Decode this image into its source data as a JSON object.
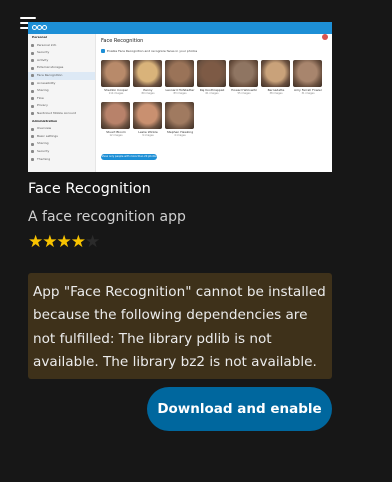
{
  "menu": {
    "icon": "hamburger-icon"
  },
  "preview": {
    "title": "Face Recognition",
    "checkbox_label": "Enable Face Recognition and recognize faces in your photos",
    "button_label": "Show only people with more than 20 photos",
    "sidebar": [
      {
        "label": "Personal",
        "head": true
      },
      {
        "label": "Personal info"
      },
      {
        "label": "Security"
      },
      {
        "label": "Activity"
      },
      {
        "label": "External storages"
      },
      {
        "label": "Face Recognition",
        "active": true
      },
      {
        "label": "Accessibility"
      },
      {
        "label": "Sharing"
      },
      {
        "label": "Flow"
      },
      {
        "label": "Privacy"
      },
      {
        "label": "Nextcloud Mobile Account"
      },
      {
        "label": "Administration",
        "head": true
      },
      {
        "label": "Overview"
      },
      {
        "label": "Basic settings"
      },
      {
        "label": "Sharing"
      },
      {
        "label": "Security"
      },
      {
        "label": "Theming"
      }
    ],
    "faces": [
      {
        "name": "Sheldon Cooper",
        "count": "114 images",
        "color": "#b88a6a"
      },
      {
        "name": "Penny",
        "count": "89 images",
        "color": "#d9b37a"
      },
      {
        "name": "Leonard Hofstadter",
        "count": "83 images",
        "color": "#9a7358"
      },
      {
        "name": "Raj Koothrappali",
        "count": "61 images",
        "color": "#7d5a45"
      },
      {
        "name": "Howard Wolowitz",
        "count": "55 images",
        "color": "#8f7562"
      },
      {
        "name": "Bernadette",
        "count": "38 images",
        "color": "#c9a27a"
      },
      {
        "name": "Amy Farrah Fowler",
        "count": "31 images",
        "color": "#a8856d"
      },
      {
        "name": "Stuart Bloom",
        "count": "12 images",
        "color": "#b8826a"
      },
      {
        "name": "Leslie Winkle",
        "count": "9 images",
        "color": "#c99070"
      },
      {
        "name": "Stephen Hawking",
        "count": "4 images",
        "color": "#a07a60"
      }
    ]
  },
  "app": {
    "name": "Face Recognition",
    "summary": "A face recognition app",
    "rating": {
      "value": 4,
      "max": 5
    },
    "warning": "App \"Face Recognition\" cannot be installed because the following dependencies are not fulfilled: The library pdlib is not available. The library bz2 is not available.",
    "download_button": "Download and enable"
  },
  "colors": {
    "background": "#171717",
    "warning_bg": "#3e311a",
    "button_bg": "#00679e",
    "star": "#f8c300",
    "preview_header": "#1d8fd6"
  }
}
